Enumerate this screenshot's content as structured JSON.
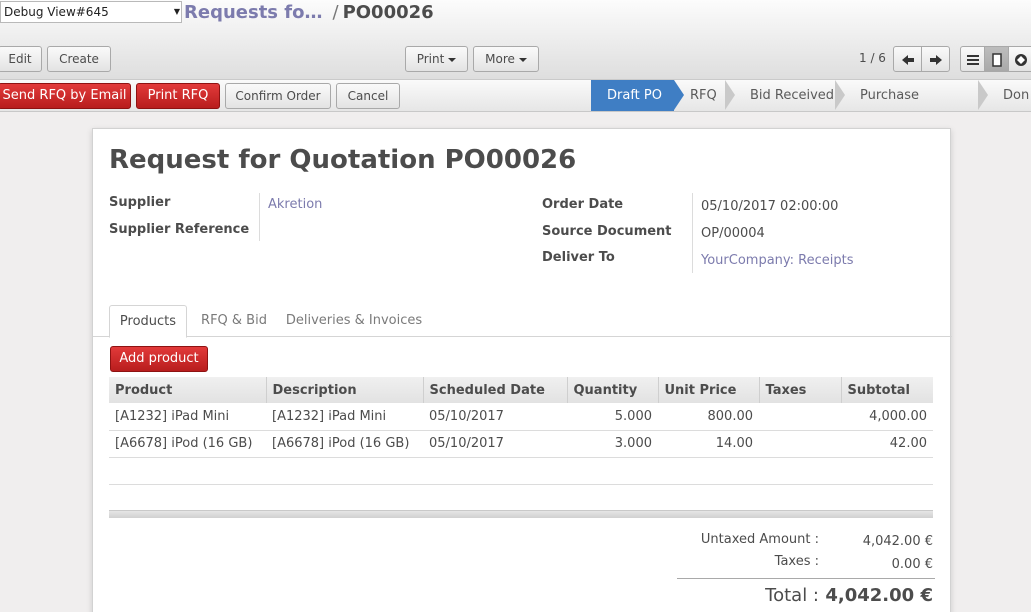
{
  "header": {
    "debug_select": "Debug View#645",
    "breadcrumb_parent": "Requests fo…",
    "breadcrumb_current": "PO00026"
  },
  "toolbar": {
    "edit_label": "Edit",
    "create_label": "Create",
    "print_label": "Print",
    "more_label": "More",
    "pager": "1 / 6"
  },
  "statusbar": {
    "send_rfq_label": "Send RFQ by Email",
    "print_rfq_label": "Print RFQ",
    "confirm_label": "Confirm Order",
    "cancel_label": "Cancel",
    "stages": [
      "Draft PO",
      "RFQ",
      "Bid Received",
      "Purchase Confirmed",
      "Don"
    ],
    "active_stage": "Draft PO",
    "accent": "#3f7ec4"
  },
  "form": {
    "title": "Request for Quotation PO00026",
    "supplier_label": "Supplier",
    "supplier_value": "Akretion",
    "supplier_ref_label": "Supplier Reference",
    "order_date_label": "Order Date",
    "order_date_value": "05/10/2017 02:00:00",
    "source_doc_label": "Source Document",
    "source_doc_value": "OP/00004",
    "deliver_to_label": "Deliver To",
    "deliver_to_value": "YourCompany: Receipts"
  },
  "tabs": [
    "Products",
    "RFQ & Bid",
    "Deliveries & Invoices"
  ],
  "lines": {
    "add_label": "Add product",
    "columns": [
      "Product",
      "Description",
      "Scheduled Date",
      "Quantity",
      "Unit Price",
      "Taxes",
      "Subtotal"
    ],
    "rows": [
      [
        "[A1232] iPad Mini",
        "[A1232] iPad Mini",
        "05/10/2017",
        "5.000",
        "800.00",
        "",
        "4,000.00"
      ],
      [
        "[A6678] iPod (16 GB)",
        "[A6678] iPod (16 GB)",
        "05/10/2017",
        "3.000",
        "14.00",
        "",
        "42.00"
      ]
    ]
  },
  "totals": {
    "untaxed_label": "Untaxed Amount :",
    "untaxed_value": "4,042.00 €",
    "taxes_label": "Taxes :",
    "taxes_value": "0.00 €",
    "total_label": "Total :",
    "total_value": "4,042.00 €"
  },
  "colors": {
    "primary_red": "#c62828",
    "link": "#7c7bad"
  }
}
